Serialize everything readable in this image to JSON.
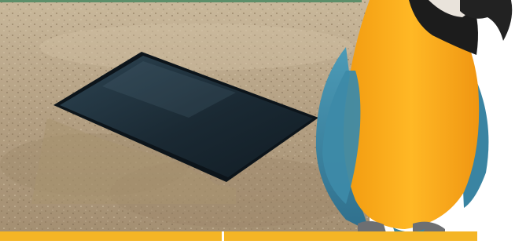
{
  "photo": {
    "subject": "blue-and-yellow-macaw-beside-tablet",
    "colors": {
      "sand": "#b9a688",
      "tablet": "#1b2a34",
      "parrot_yellow": "#f7a71a",
      "parrot_blue": "#3f8aa7",
      "accent_bar": "#f4b526",
      "top_strip": "#5d8f6a"
    }
  }
}
